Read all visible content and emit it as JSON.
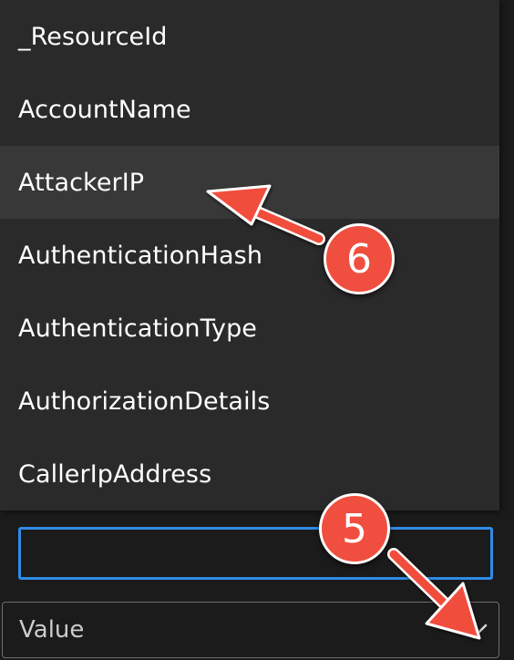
{
  "dropdown": {
    "items": [
      {
        "label": "_ResourceId",
        "highlighted": false
      },
      {
        "label": "AccountName",
        "highlighted": false
      },
      {
        "label": "AttackerIP",
        "highlighted": true
      },
      {
        "label": "AuthenticationHash",
        "highlighted": false
      },
      {
        "label": "AuthenticationType",
        "highlighted": false
      },
      {
        "label": "AuthorizationDetails",
        "highlighted": false
      },
      {
        "label": "CallerIpAddress",
        "highlighted": false
      }
    ]
  },
  "search_input": {
    "value": "",
    "placeholder": ""
  },
  "value_select": {
    "label": "Value"
  },
  "callouts": {
    "step5": "5",
    "step6": "6",
    "color": "#f04e3e"
  },
  "colors": {
    "panel_bg": "#2a2a2a",
    "highlight_bg": "#383838",
    "input_focus_border": "#2f8ce8",
    "page_bg": "#1b1b1b"
  },
  "icons": {
    "value_select_icon": "chevron-down-icon"
  }
}
